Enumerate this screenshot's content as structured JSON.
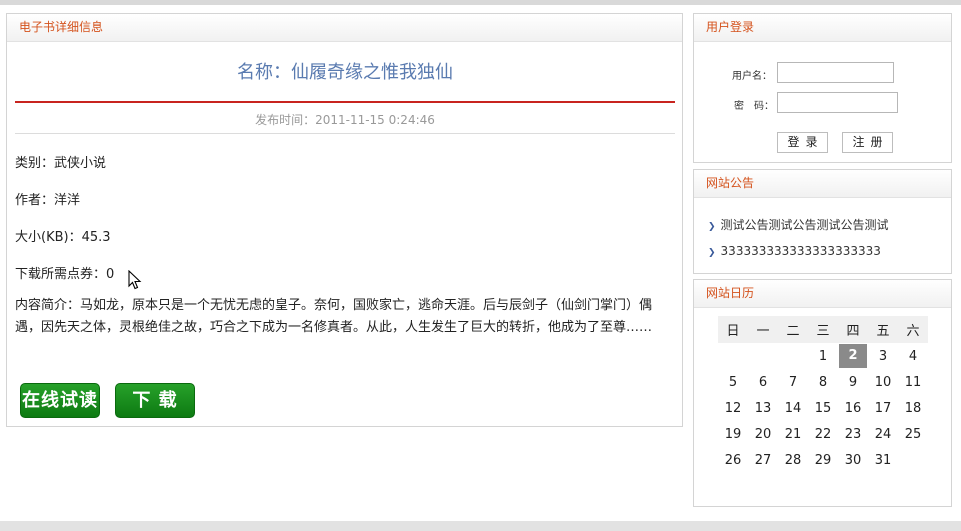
{
  "detail": {
    "header": "电子书详细信息",
    "title": "名称：仙履奇缘之惟我独仙",
    "publish_time": "发布时间：2011-11-15 0:24:46",
    "category": "类别：武侠小说",
    "author": "作者：洋洋",
    "size": "大小(KB)：45.3",
    "points": "下载所需点券：0",
    "intro": "内容简介：马如龙，原本只是一个无忧无虑的皇子。奈何，国败家亡，逃命天涯。后与辰剑子（仙剑门掌门）偶遇，因先天之体，灵根绝佳之故，巧合之下成为一名修真者。从此，人生发生了巨大的转折，他成为了至尊……",
    "read_button": "在线试读",
    "download_button": "下 载"
  },
  "login": {
    "header": "用户登录",
    "username_label": "用户名：",
    "password_label": "密　码：",
    "username_value": "",
    "password_value": "",
    "login_button": "登录",
    "register_button": "注册"
  },
  "notice": {
    "header": "网站公告",
    "items": [
      "测试公告测试公告测试公告测试",
      "333333333333333333333"
    ]
  },
  "calendar": {
    "header": "网站日历",
    "weekdays": [
      "日",
      "一",
      "二",
      "三",
      "四",
      "五",
      "六"
    ],
    "today": "2",
    "weeks": [
      [
        "",
        "",
        "",
        "1",
        "2",
        "3",
        "4"
      ],
      [
        "5",
        "6",
        "7",
        "8",
        "9",
        "10",
        "11"
      ],
      [
        "12",
        "13",
        "14",
        "15",
        "16",
        "17",
        "18"
      ],
      [
        "19",
        "20",
        "21",
        "22",
        "23",
        "24",
        "25"
      ],
      [
        "26",
        "27",
        "28",
        "29",
        "30",
        "31",
        ""
      ]
    ]
  },
  "colors": {
    "header_text": "#d4521c",
    "title_text": "#5a7bb0",
    "rule_red": "#c8241f",
    "button_green": "#0d7a12",
    "today_bg": "#8a8a8a"
  }
}
